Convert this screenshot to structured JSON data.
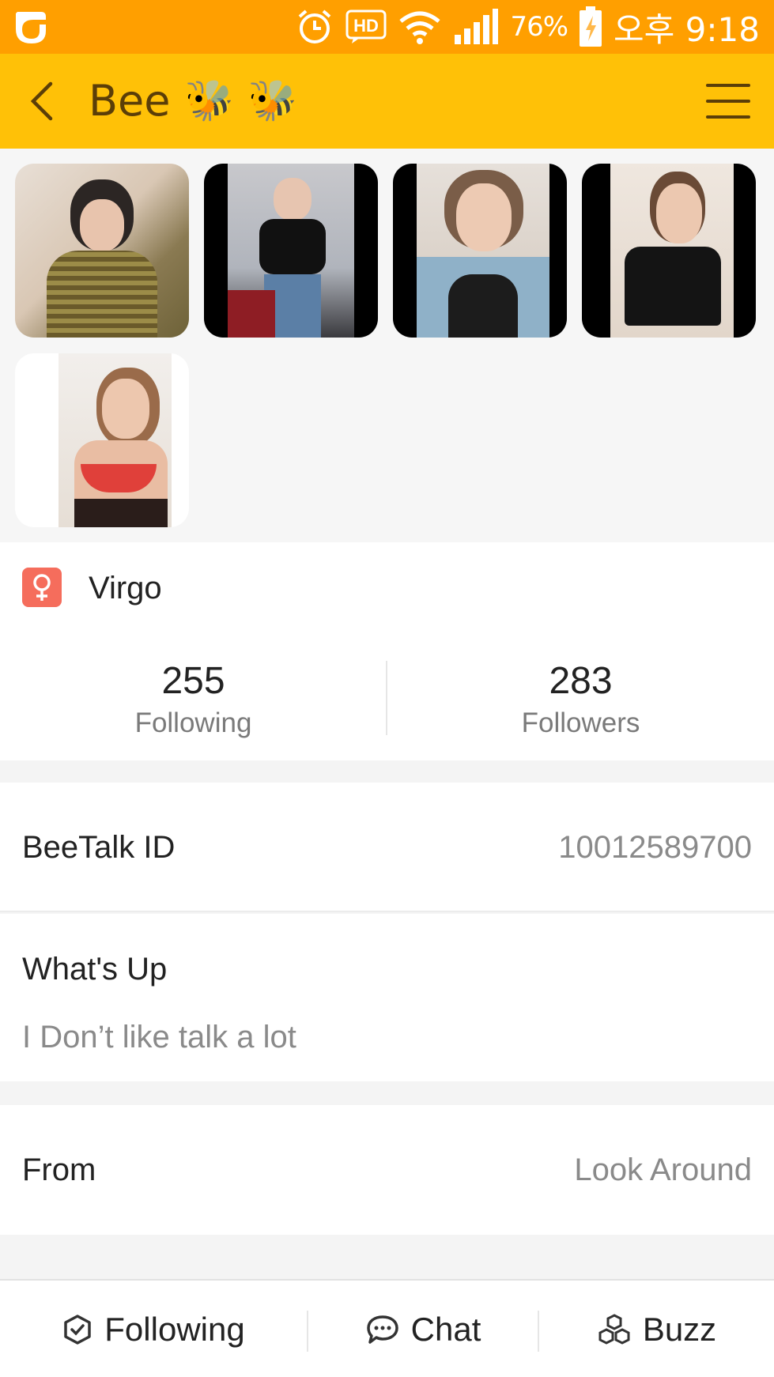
{
  "status_bar": {
    "battery_percent": "76%",
    "time": "오후 9:18",
    "hd_label": "HD"
  },
  "app_bar": {
    "title": "Bee",
    "title_emoji_1": "🐝",
    "title_emoji_2": "🐝"
  },
  "profile": {
    "zodiac": "Virgo",
    "following_count": "255",
    "following_label": "Following",
    "followers_count": "283",
    "followers_label": "Followers"
  },
  "details": {
    "id_label": "BeeTalk ID",
    "id_value": "10012589700",
    "whatsup_label": "What's Up",
    "whatsup_value": "I Don’t like talk a lot",
    "from_label": "From",
    "from_value": "Look Around"
  },
  "bottom_bar": {
    "following": "Following",
    "chat": "Chat",
    "buzz": "Buzz"
  },
  "colors": {
    "status_bar": "#ff9f00",
    "app_bar": "#ffc107",
    "title": "#5b3e08",
    "gender_badge": "#f56d5c"
  }
}
